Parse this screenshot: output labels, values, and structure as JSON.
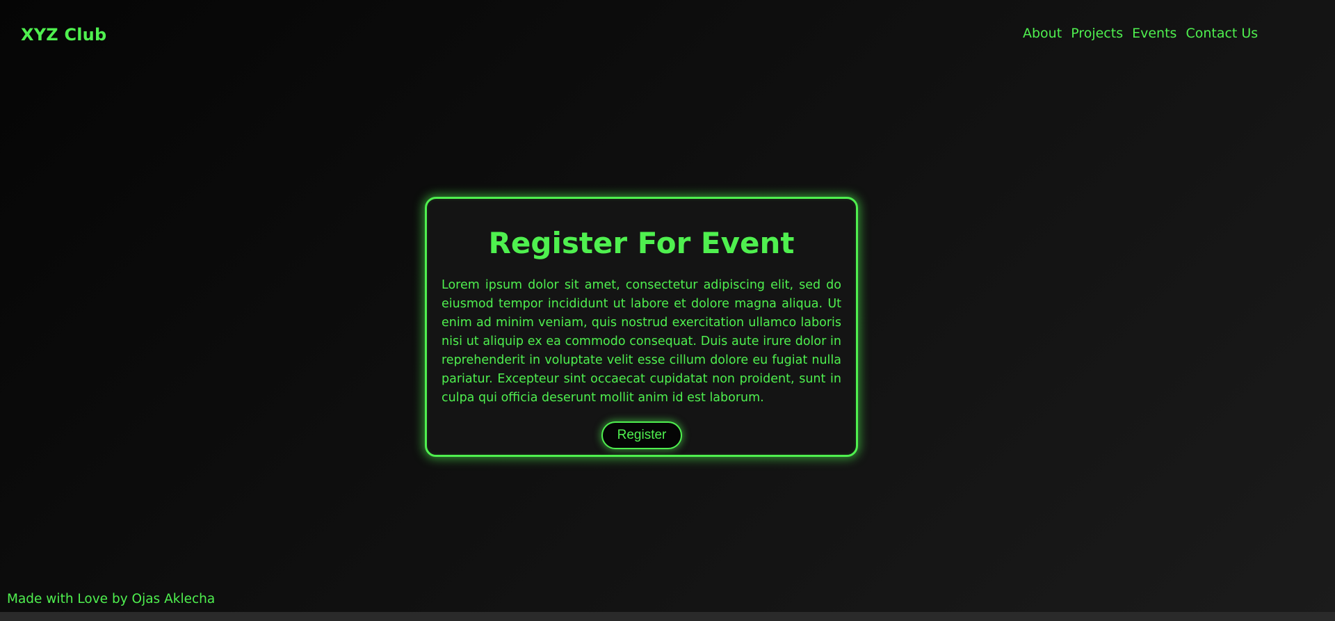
{
  "brand": {
    "name": "XYZ Club",
    "accent_color": "#4ff04f"
  },
  "nav": {
    "items": [
      {
        "label": "About"
      },
      {
        "label": "Projects"
      },
      {
        "label": "Events"
      },
      {
        "label": "Contact Us"
      }
    ]
  },
  "card": {
    "title": "Register For Event",
    "body": "Lorem ipsum dolor sit amet, consectetur adipiscing elit, sed do eiusmod tempor incididunt ut labore et dolore magna aliqua. Ut enim ad minim veniam, quis nostrud exercitation ullamco laboris nisi ut aliquip ex ea commodo consequat. Duis aute irure dolor in reprehenderit in voluptate velit esse cillum dolore eu fugiat nulla pariatur. Excepteur sint occaecat cupidatat non proident, sunt in culpa qui officia deserunt mollit anim id est laborum.",
    "button_label": "Register"
  },
  "footer": {
    "text": "Made with Love by Ojas Aklecha"
  }
}
